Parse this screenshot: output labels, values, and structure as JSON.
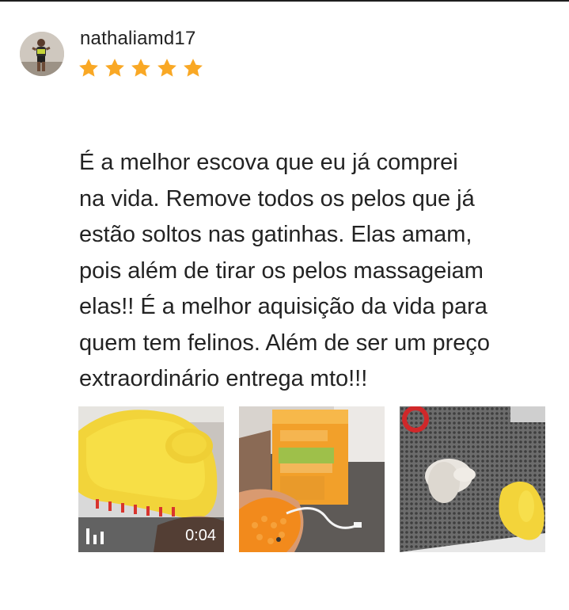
{
  "review": {
    "username": "nathaliamd17",
    "rating": 5,
    "rating_max": 5,
    "text": "É a melhor escova que eu já comprei\nna vida. Remove todos os pelos que já\nestão soltos nas gatinhas. Elas amam,\npois além de tirar os pelos massageiam\nelas!! É a melhor aquisição da vida para\nquem tem felinos. Além de ser um preço\nextraordinário entrega mto!!!"
  },
  "media": [
    {
      "type": "video",
      "duration": "0:04",
      "icon": "video-bars-icon"
    },
    {
      "type": "photo"
    },
    {
      "type": "photo"
    }
  ],
  "colors": {
    "star": "#f9a825",
    "text": "#232323",
    "background": "#ffffff"
  }
}
